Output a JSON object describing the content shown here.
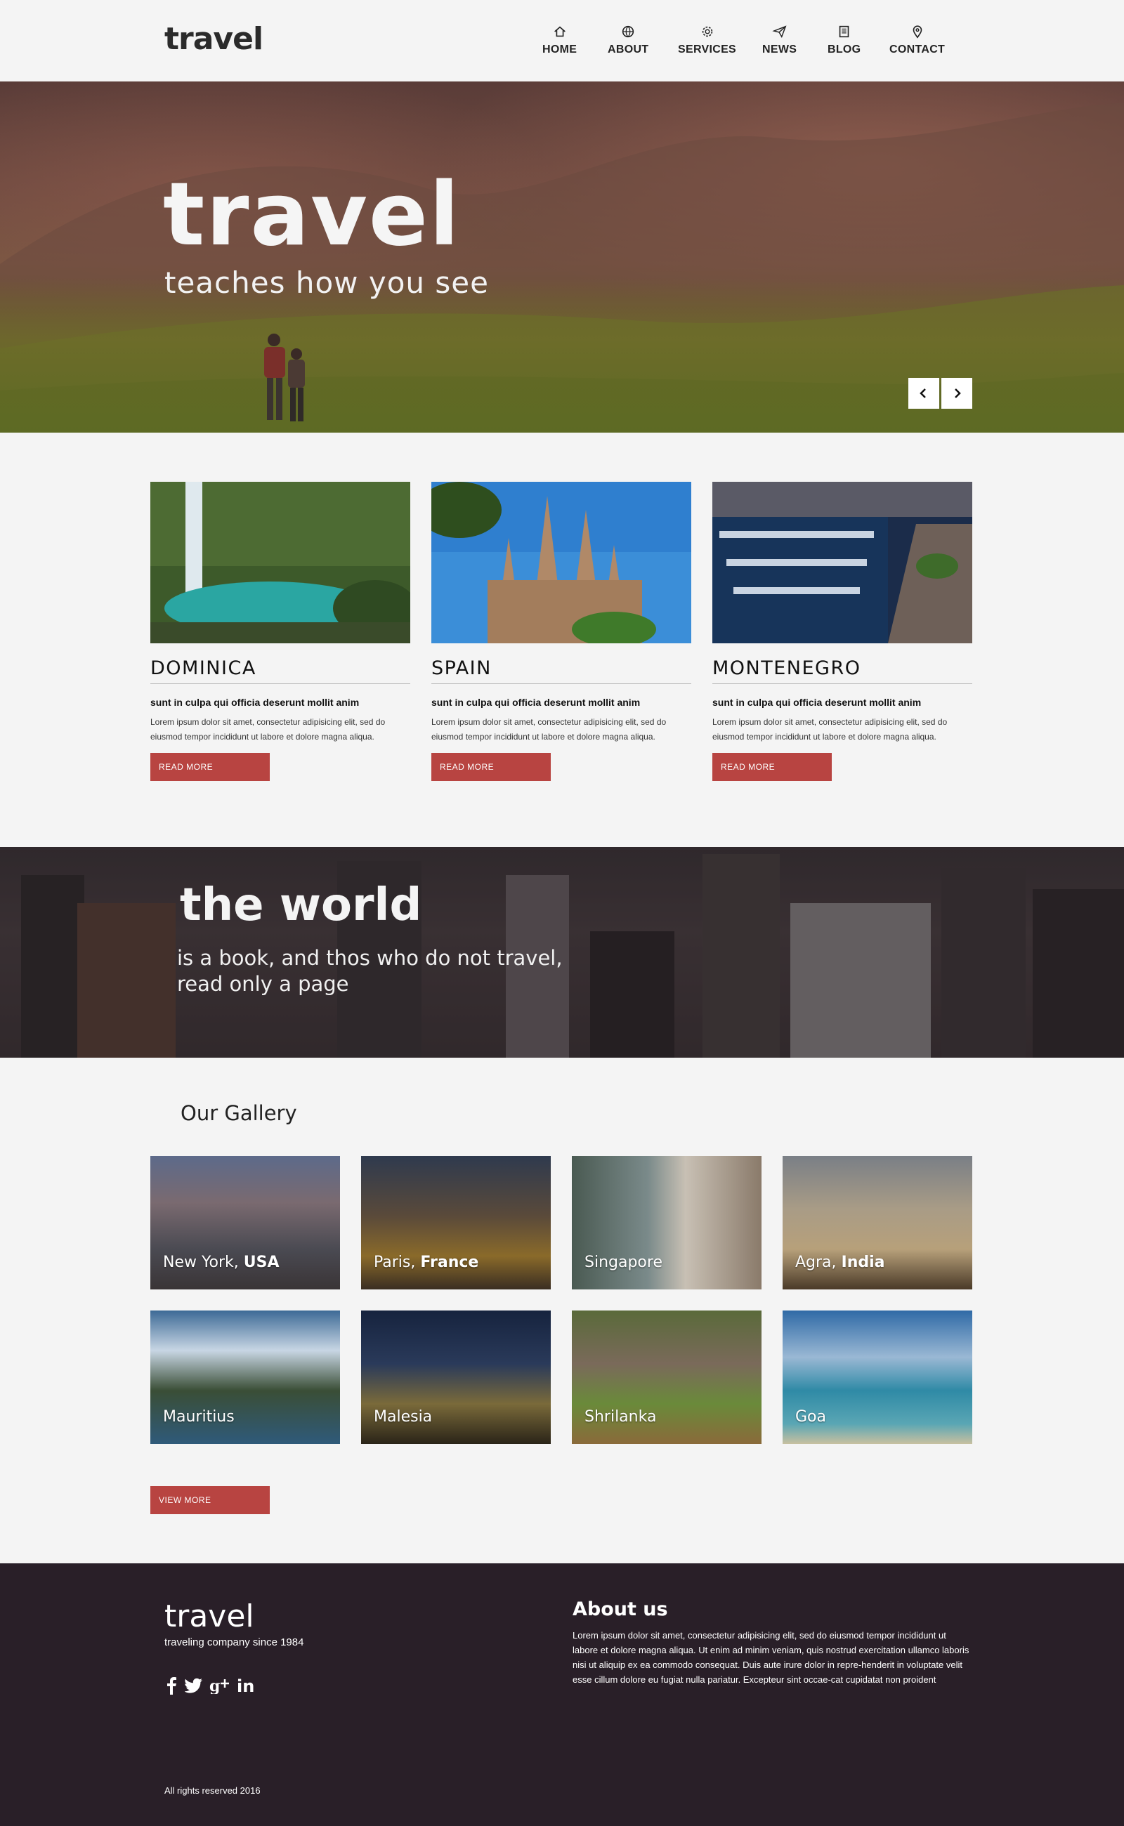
{
  "header": {
    "logo": "travel",
    "nav": [
      {
        "label": "HOME",
        "icon": "home-icon"
      },
      {
        "label": "ABOUT",
        "icon": "globe-icon"
      },
      {
        "label": "SERVICES",
        "icon": "gear-icon"
      },
      {
        "label": "NEWS",
        "icon": "paper-plane-icon"
      },
      {
        "label": "BLOG",
        "icon": "book-icon"
      },
      {
        "label": "CONTACT",
        "icon": "map-pin-icon"
      }
    ]
  },
  "hero": {
    "title": "travel",
    "subtitle": "teaches how you see"
  },
  "destinations": [
    {
      "name": "DOMINICA",
      "subtitle": "sunt in culpa qui officia deserunt mollit anim",
      "body": "Lorem ipsum dolor sit amet, consectetur adipisicing elit, sed do eiusmod tempor incididunt ut labore et dolore magna aliqua.",
      "button": "READ MORE"
    },
    {
      "name": "SPAIN",
      "subtitle": "sunt in culpa qui officia deserunt mollit anim",
      "body": "Lorem ipsum dolor sit amet, consectetur adipisicing elit, sed do eiusmod tempor incididunt ut labore et dolore magna aliqua.",
      "button": "READ MORE"
    },
    {
      "name": "MONTENEGRO",
      "subtitle": "sunt in culpa qui officia deserunt mollit anim",
      "body": "Lorem ipsum dolor sit amet, consectetur adipisicing elit, sed do eiusmod tempor incididunt ut labore et dolore magna aliqua.",
      "button": "READ MORE"
    }
  ],
  "world": {
    "title": "the world",
    "line1": "is a book, and thos who do not travel,",
    "line2": "read only a page"
  },
  "gallery": {
    "title": "Our Gallery",
    "tiles": [
      {
        "city": "New York,",
        "country": "USA"
      },
      {
        "city": "Paris,",
        "country": "France"
      },
      {
        "city": "Singapore",
        "country": ""
      },
      {
        "city": "Agra,",
        "country": "India"
      },
      {
        "city": "Mauritius",
        "country": ""
      },
      {
        "city": "Malesia",
        "country": ""
      },
      {
        "city": "Shrilanka",
        "country": ""
      },
      {
        "city": "Goa",
        "country": ""
      }
    ],
    "button": "VIEW MORE"
  },
  "footer": {
    "logo": "travel",
    "tagline": "traveling company since 1984",
    "social": [
      "facebook-icon",
      "twitter-icon",
      "google-plus-icon",
      "linkedin-icon"
    ],
    "about_title": "About us",
    "about_text": "Lorem ipsum dolor sit amet, consectetur adipisicing elit, sed do eiusmod tempor incididunt ut labore et dolore magna aliqua. Ut enim ad minim veniam, quis nostrud exercitation ullamco laboris nisi ut aliquip ex ea commodo consequat. Duis aute irure dolor in repre-henderit in voluptate velit esse cillum dolore eu fugiat nulla pariatur. Excepteur sint occae-cat cupidatat non proident",
    "copyright": "All rights reserved 2016"
  },
  "colors": {
    "accent": "#b84441",
    "footer_bg": "#291f28",
    "page_bg": "#f4f4f4"
  }
}
